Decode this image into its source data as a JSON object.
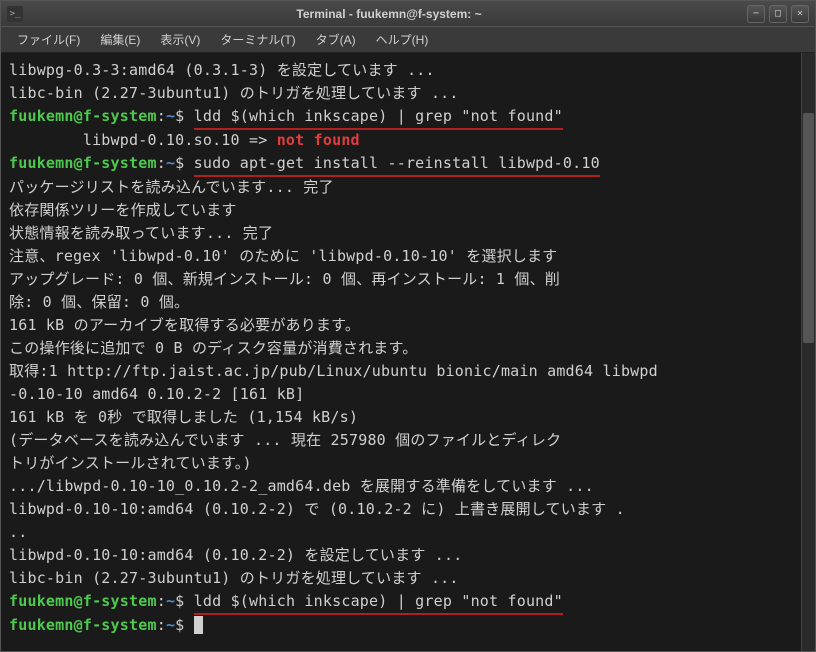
{
  "window": {
    "title": "Terminal - fuukemn@f-system: ~"
  },
  "controls": {
    "minimize": "−",
    "maximize": "□",
    "close": "×"
  },
  "menu": {
    "file": "ファイル(F)",
    "edit": "編集(E)",
    "view": "表示(V)",
    "terminal": "ターミナル(T)",
    "tabs": "タブ(A)",
    "help": "ヘルプ(H)"
  },
  "prompt": {
    "user_host": "fuukemn@f-system",
    "sep": ":",
    "path": "~",
    "dollar": "$"
  },
  "lines": {
    "l1": "libwpg-0.3-3:amd64 (0.3.1-3) を設定しています ...",
    "l2": "libc-bin (2.27-3ubuntu1) のトリガを処理しています ...",
    "cmd1": "ldd $(which inkscape) | grep \"not found\"",
    "l3a": "        libwpd-0.10.so.10 => ",
    "l3b": "not found",
    "cmd2": "sudo apt-get install --reinstall libwpd-0.10",
    "l4": "パッケージリストを読み込んでいます... 完了",
    "l5": "依存関係ツリーを作成しています",
    "l6": "状態情報を読み取っています... 完了",
    "l7": "注意、regex 'libwpd-0.10' のために 'libwpd-0.10-10' を選択します",
    "l8": "アップグレード: 0 個、新規インストール: 0 個、再インストール: 1 個、削",
    "l9": "除: 0 個、保留: 0 個。",
    "l10": "161 kB のアーカイブを取得する必要があります。",
    "l11": "この操作後に追加で 0 B のディスク容量が消費されます。",
    "l12": "取得:1 http://ftp.jaist.ac.jp/pub/Linux/ubuntu bionic/main amd64 libwpd",
    "l13": "-0.10-10 amd64 0.10.2-2 [161 kB]",
    "l14": "161 kB を 0秒 で取得しました (1,154 kB/s)",
    "l15": "(データベースを読み込んでいます ... 現在 257980 個のファイルとディレク",
    "l16": "トリがインストールされています。)",
    "l17": ".../libwpd-0.10-10_0.10.2-2_amd64.deb を展開する準備をしています ...",
    "l18": "libwpd-0.10-10:amd64 (0.10.2-2) で (0.10.2-2 に) 上書き展開しています .",
    "l19": "..",
    "l20": "libwpd-0.10-10:amd64 (0.10.2-2) を設定しています ...",
    "l21": "libc-bin (2.27-3ubuntu1) のトリガを処理しています ...",
    "cmd3": "ldd $(which inkscape) | grep \"not found\""
  }
}
